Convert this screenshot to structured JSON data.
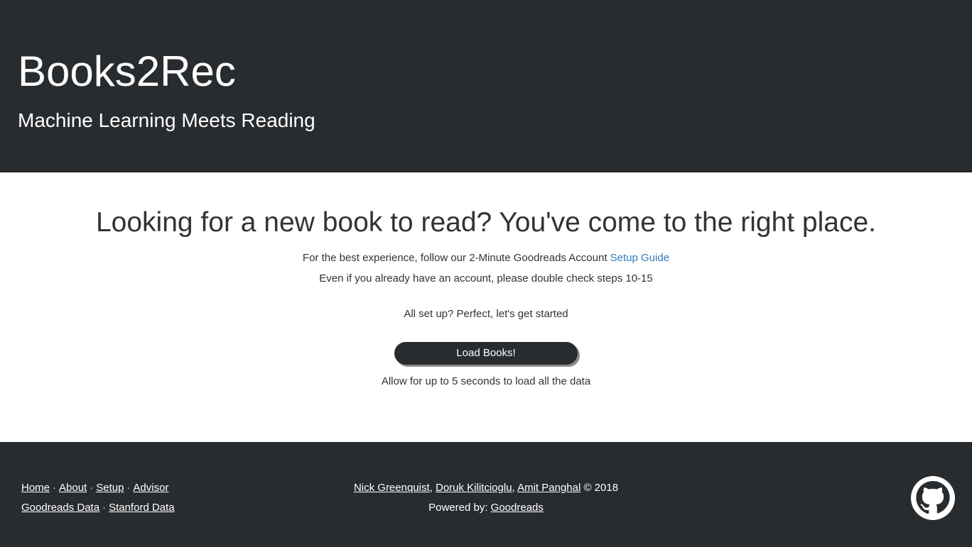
{
  "header": {
    "title": "Books2Rec",
    "subtitle": "Machine Learning Meets Reading"
  },
  "main": {
    "headline": "Looking for a new book to read? You've come to the right place.",
    "intro_text": "For the best experience, follow our 2-Minute Goodreads Account ",
    "setup_link": "Setup Guide",
    "note": "Even if you already have an account, please double check steps 10-15",
    "ready_text": "All set up? Perfect, let's get started",
    "load_button": "Load Books!",
    "load_note": "Allow for up to 5 seconds to load all the data"
  },
  "footer": {
    "nav": [
      "Home",
      "About",
      "Setup",
      "Advisor"
    ],
    "data_links": [
      "Goodreads Data",
      "Stanford Data"
    ],
    "separator": "·",
    "authors": [
      "Nick Greenquist",
      "Doruk Kilitcioglu",
      "Amit Panghal"
    ],
    "author_sep": ",",
    "copyright": "© 2018",
    "powered_label": "Powered by: ",
    "powered_link": "Goodreads",
    "github_icon": "github-icon"
  },
  "colors": {
    "dark": "#292c2f",
    "link": "#337ab7",
    "text": "#333333"
  }
}
